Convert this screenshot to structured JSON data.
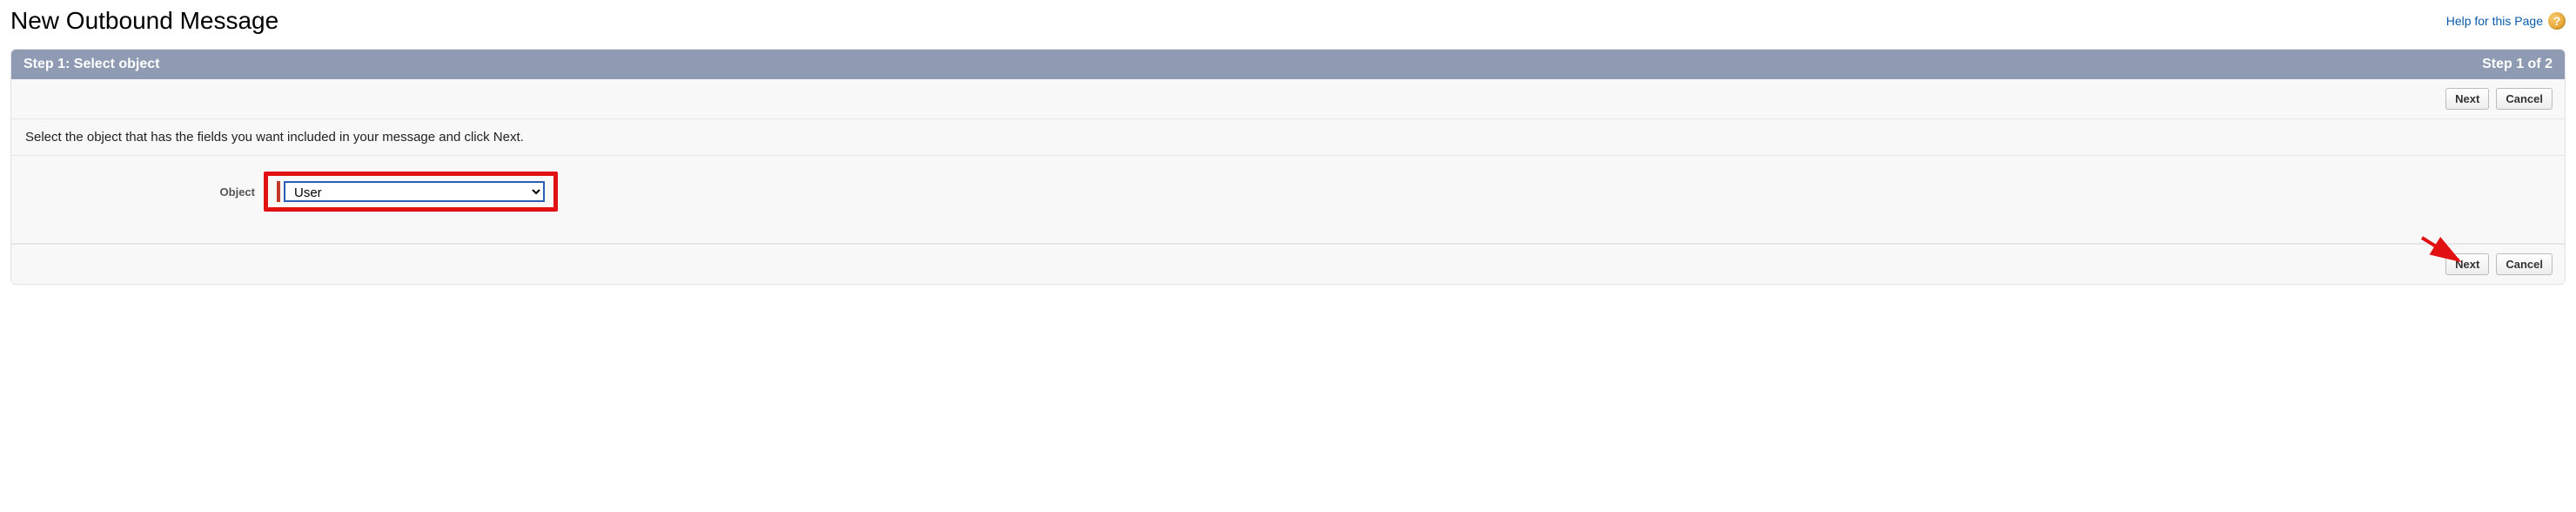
{
  "header": {
    "title": "New Outbound Message",
    "help_text": "Help for this Page"
  },
  "panel": {
    "step_left": "Step 1: Select object",
    "step_right": "Step 1 of 2",
    "instruction": "Select the object that has the fields you want included in your message and click Next.",
    "object_label": "Object",
    "object_value": "User"
  },
  "buttons": {
    "next": "Next",
    "cancel": "Cancel"
  }
}
